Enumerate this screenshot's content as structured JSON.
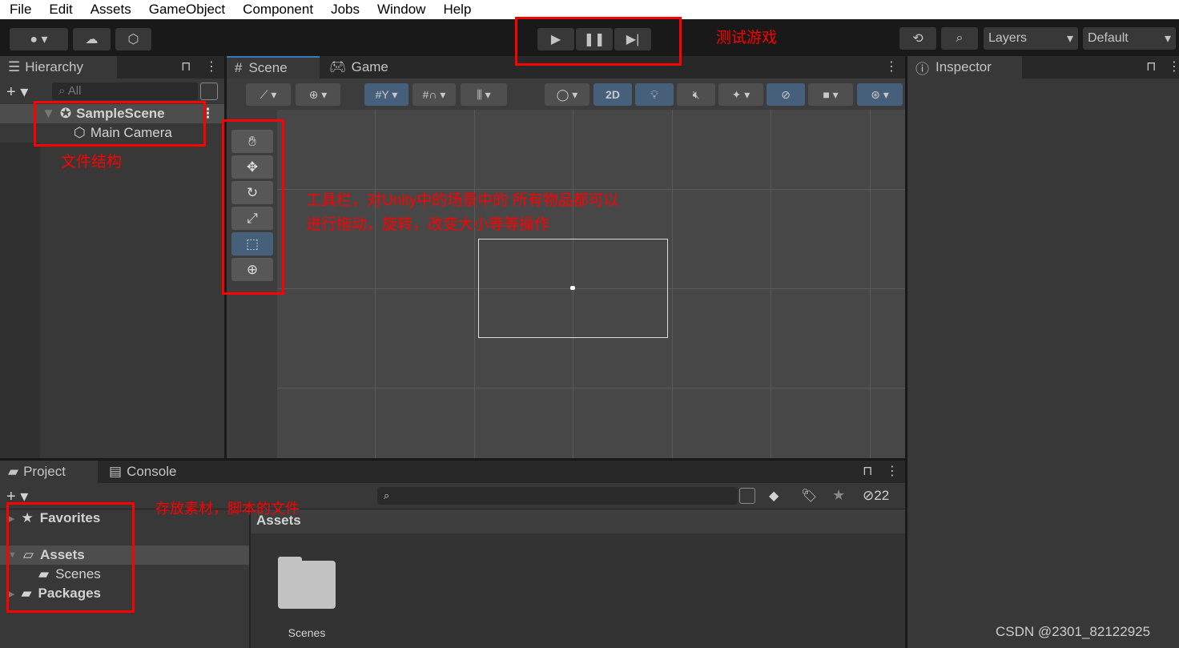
{
  "menu": [
    "File",
    "Edit",
    "Assets",
    "GameObject",
    "Component",
    "Jobs",
    "Window",
    "Help"
  ],
  "toolbar": {
    "layers": "Layers",
    "layout": "Default",
    "icons": [
      "account-icon",
      "cloud-icon",
      "unity-devops-icon",
      "play-icon",
      "pause-icon",
      "step-icon",
      "history-icon",
      "search-icon"
    ]
  },
  "hierarchy": {
    "tab": "Hierarchy",
    "search_placeholder": "All",
    "scene": "SampleScene",
    "items": [
      "Main Camera"
    ]
  },
  "scene": {
    "tabs": [
      "Scene",
      "Game"
    ],
    "btn_2d": "2D",
    "tools": [
      "hand-tool",
      "move-tool",
      "rotate-tool",
      "scale-tool",
      "rect-tool",
      "transform-tool"
    ],
    "active_tool": "rect-tool"
  },
  "inspector": {
    "tab": "Inspector"
  },
  "project": {
    "tabs": [
      "Project",
      "Console"
    ],
    "tree": [
      "Favorites",
      "Assets",
      "Scenes",
      "Packages"
    ],
    "breadcrumb": "Assets",
    "folder": "Scenes",
    "hidden_count": "22"
  },
  "annotations": {
    "hierarchy": "文件结构",
    "play": "测试游戏",
    "tools_line1": "工具栏，对Unity中的场景中的 所有物品都可以",
    "tools_line2": "进行拖动，旋转，改变大小等等操作",
    "project": "存放素材，脚本的文件"
  },
  "watermark": "CSDN @2301_82122925",
  "colors": {
    "annotation": "#ff0000",
    "selected": "#46607c"
  }
}
